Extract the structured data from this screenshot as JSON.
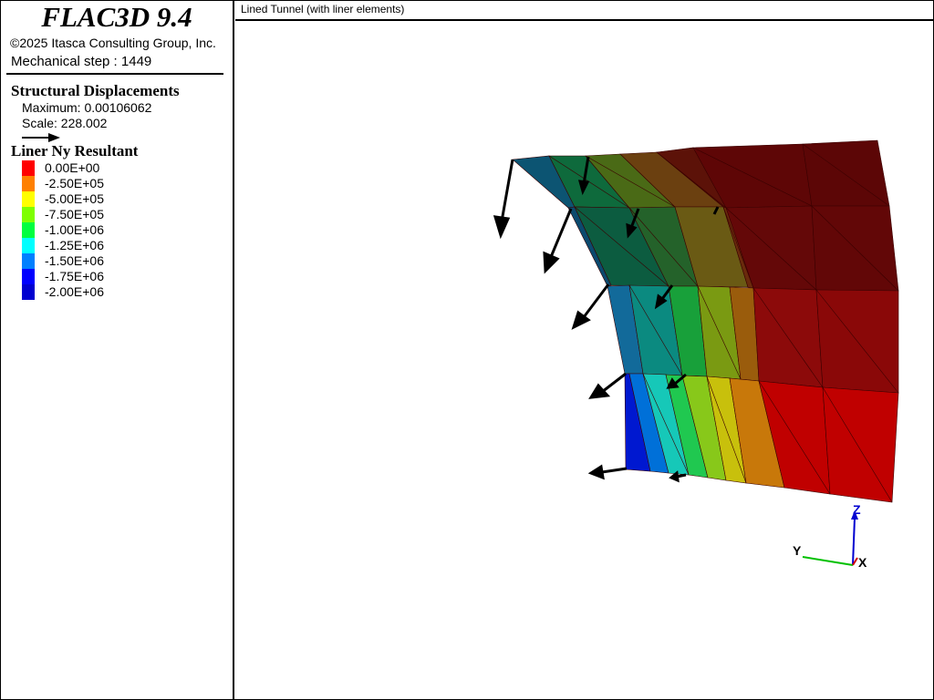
{
  "app": {
    "title": "FLAC3D 9.4",
    "copyright": "©2025 Itasca Consulting Group, Inc.",
    "step": "Mechanical step : 1449"
  },
  "plot": {
    "title": "Lined Tunnel (with liner elements)"
  },
  "displacement_legend": {
    "title": "Structural Displacements",
    "maximum": "Maximum: 0.00106062",
    "scale": "Scale: 228.002",
    "arrow_icon": "arrow-right-icon"
  },
  "ny_legend": {
    "title": "Liner Ny Resultant",
    "items": [
      {
        "label": "0.00E+00",
        "color": "#ff0000"
      },
      {
        "label": "-2.50E+05",
        "color": "#ff8000"
      },
      {
        "label": "-5.00E+05",
        "color": "#ffff00"
      },
      {
        "label": "-7.50E+05",
        "color": "#7fff00"
      },
      {
        "label": "-1.00E+06",
        "color": "#00ff40"
      },
      {
        "label": "-1.25E+06",
        "color": "#00ffff"
      },
      {
        "label": "-1.50E+06",
        "color": "#0080ff"
      },
      {
        "label": "-1.75E+06",
        "color": "#0000ff"
      },
      {
        "label": "-2.00E+06",
        "color": "#0000d0"
      }
    ]
  },
  "axes": {
    "z": "Z",
    "y": "Y",
    "x": "X"
  }
}
